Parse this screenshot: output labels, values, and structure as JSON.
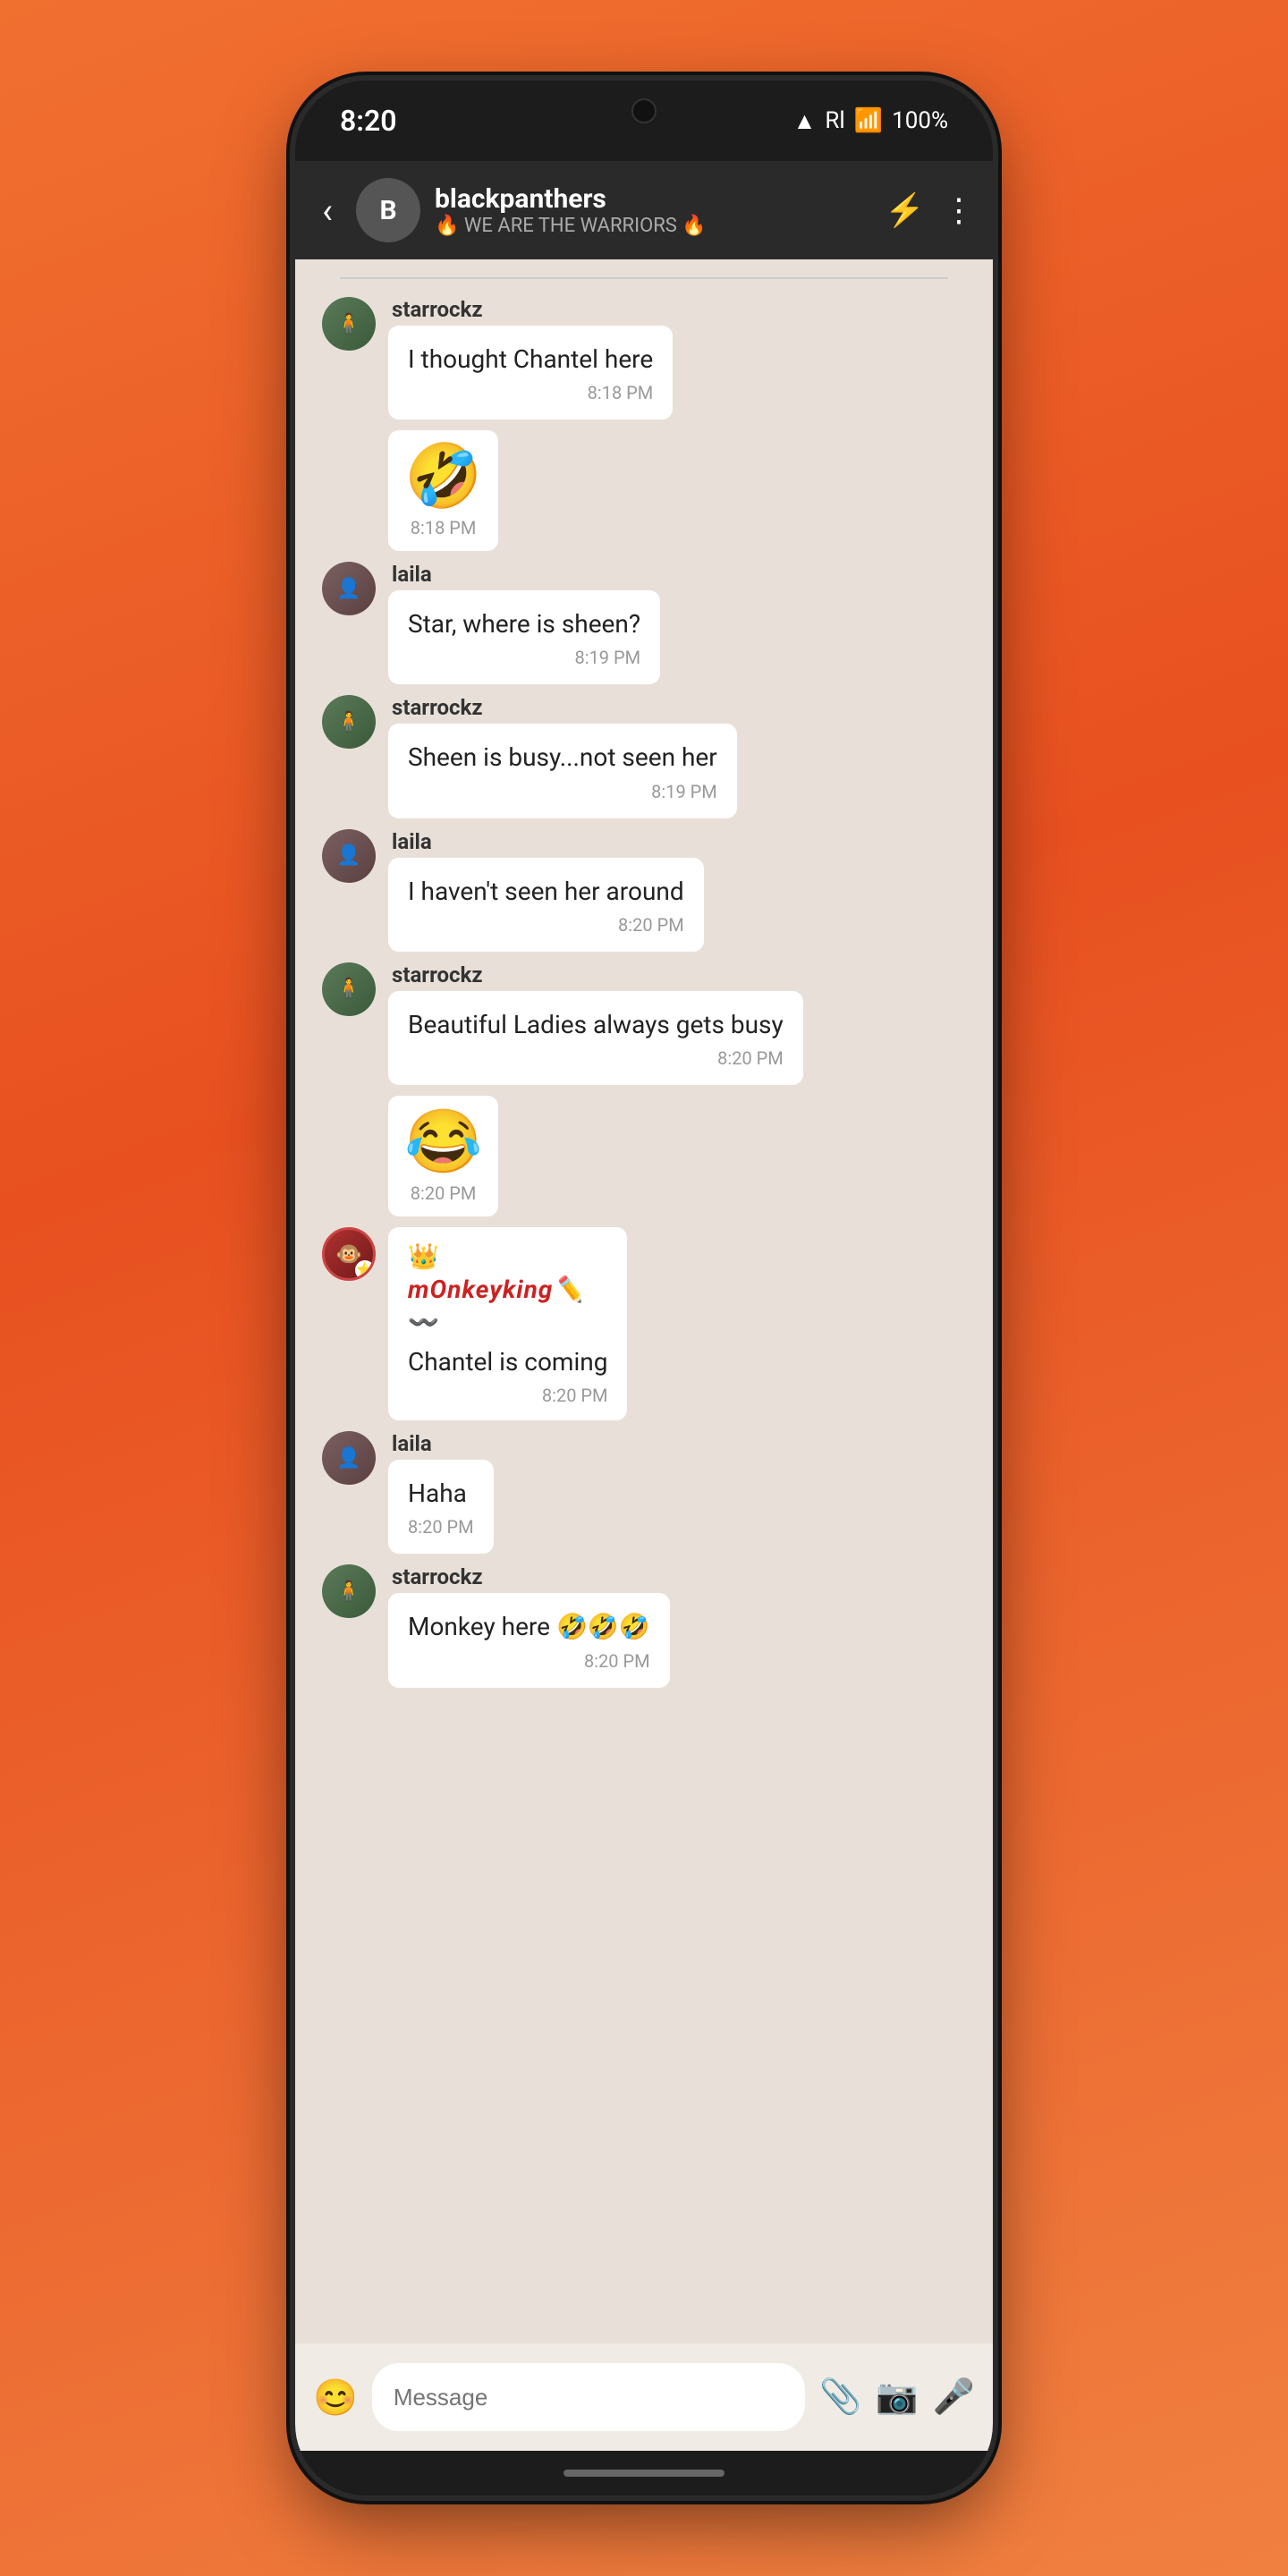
{
  "status_bar": {
    "time": "8:20",
    "battery": "100%",
    "wifi_icon": "wifi",
    "signal_icon": "signal"
  },
  "nav": {
    "group_name": "blackpanthers",
    "subtitle": "🔥 WE ARE THE WARRIORS 🔥",
    "avatar_letter": "B",
    "back_icon": "‹",
    "flash_icon": "⚡",
    "more_icon": "⋮"
  },
  "messages": [
    {
      "id": "msg1",
      "sender": "starrockz",
      "avatar_type": "star",
      "text": "I thought Chantel here",
      "time": "8:18 PM",
      "type": "text"
    },
    {
      "id": "msg2",
      "sender": "",
      "avatar_type": "star",
      "text": "🤣",
      "time": "8:18 PM",
      "type": "emoji"
    },
    {
      "id": "msg3",
      "sender": "laila",
      "avatar_type": "laila",
      "text": "Star, where is sheen?",
      "time": "8:19 PM",
      "type": "text"
    },
    {
      "id": "msg4",
      "sender": "starrockz",
      "avatar_type": "star",
      "text": "Sheen is busy...not seen her",
      "time": "8:19 PM",
      "type": "text"
    },
    {
      "id": "msg5",
      "sender": "laila",
      "avatar_type": "laila",
      "text": "I haven't seen her around",
      "time": "8:20 PM",
      "type": "text"
    },
    {
      "id": "msg6",
      "sender": "starrockz",
      "avatar_type": "star",
      "text": "Beautiful Ladies always gets busy",
      "time": "8:20 PM",
      "type": "text"
    },
    {
      "id": "msg7",
      "sender": "",
      "avatar_type": "star",
      "text": "😂",
      "time": "8:20 PM",
      "type": "emoji"
    },
    {
      "id": "msg8",
      "sender": "monkeyking",
      "avatar_type": "monkey",
      "crown": "👑",
      "name_styled": "mOnkeyking🖊",
      "swirl": "〰️",
      "text": "Chantel is coming",
      "time": "8:20 PM",
      "type": "monkey"
    },
    {
      "id": "msg9",
      "sender": "laila",
      "avatar_type": "laila",
      "text": "Haha",
      "time": "8:20 PM",
      "type": "text"
    },
    {
      "id": "msg10",
      "sender": "starrockz",
      "avatar_type": "star",
      "text": "Monkey here 🤣🤣🤣",
      "time": "8:20 PM",
      "type": "text"
    }
  ],
  "input": {
    "placeholder": "Message",
    "emoji_icon": "😊",
    "attach_icon": "📎",
    "camera_icon": "📷",
    "mic_icon": "🎤"
  }
}
